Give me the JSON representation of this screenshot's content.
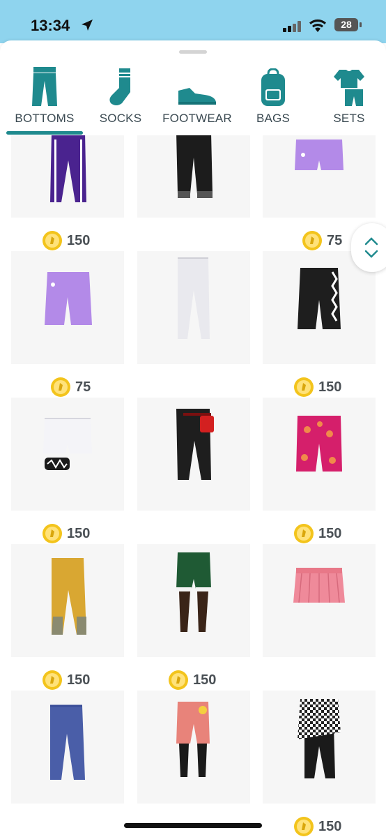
{
  "status": {
    "time": "13:34",
    "battery": "28"
  },
  "tabs": [
    {
      "label": "BOTTOMS",
      "icon": "pants-icon",
      "active": true
    },
    {
      "label": "SOCKS",
      "icon": "sock-icon",
      "active": false
    },
    {
      "label": "FOOTWEAR",
      "icon": "sneaker-icon",
      "active": false
    },
    {
      "label": "BAGS",
      "icon": "backpack-icon",
      "active": false
    },
    {
      "label": "SETS",
      "icon": "outfit-set-icon",
      "active": false
    }
  ],
  "items": [
    {
      "name": "purple track pants",
      "price": "150"
    },
    {
      "name": "black pants",
      "price": ""
    },
    {
      "name": "lavender shorts",
      "price": "75"
    },
    {
      "name": "lavender bermuda shorts",
      "price": "75"
    },
    {
      "name": "white pants",
      "price": ""
    },
    {
      "name": "black side-stripe shorts",
      "price": "150"
    },
    {
      "name": "white shorts with leg band",
      "price": "150"
    },
    {
      "name": "black pants with red belt bag",
      "price": ""
    },
    {
      "name": "pink floral shorts",
      "price": "150"
    },
    {
      "name": "gold pants",
      "price": "150"
    },
    {
      "name": "green shorts with tights",
      "price": "150"
    },
    {
      "name": "pink pleated skirt",
      "price": ""
    },
    {
      "name": "blue joggers",
      "price": ""
    },
    {
      "name": "salmon pants with boots",
      "price": ""
    },
    {
      "name": "gingham skirt over leggings",
      "price": "150"
    }
  ],
  "colors": {
    "accent": "#1f8a8e",
    "statusBar": "#8fd4ee",
    "coin": "#f3c41c"
  }
}
